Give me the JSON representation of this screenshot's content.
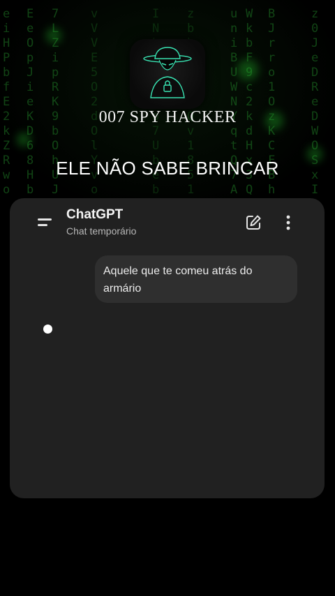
{
  "overlay": {
    "brand": "007 SPY HACKER",
    "headline": "ELE NÃO SABE BRINCAR"
  },
  "chat": {
    "title": "ChatGPT",
    "subtitle": "Chat temporário",
    "icons": {
      "menu": "menu-icon",
      "new_chat": "edit-icon",
      "more": "more-vertical-icon"
    },
    "messages": [
      {
        "role": "user",
        "text": "Aquele que te comeu atrás do armário"
      }
    ],
    "status": "typing-indicator"
  },
  "colors": {
    "background": "#000000",
    "panel": "#212121",
    "bubble": "#2f2f2f",
    "matrix_green": "#1f7a25",
    "logo_accent": "#39e3b2"
  }
}
